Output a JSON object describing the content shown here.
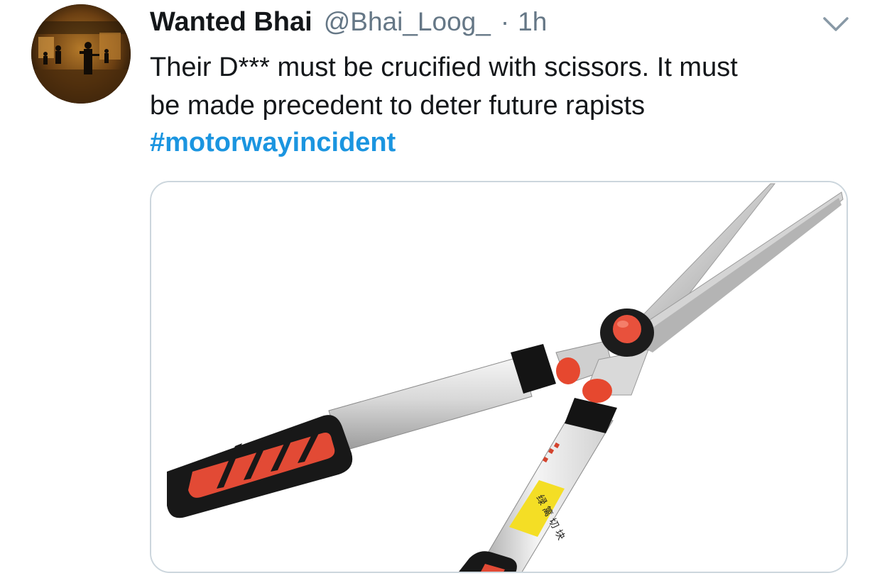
{
  "tweet": {
    "author_name": "Wanted Bhai",
    "handle": "@Bhai_Loog_",
    "separator": "·",
    "time": "1h",
    "text_lines": [
      "Their D*** must be crucified with scissors. It must",
      "be made precedent to deter future rapists"
    ],
    "hashtag": "#motorwayincident"
  },
  "icons": {
    "more": "chevron-down-icon",
    "avatar": "profile-photo"
  },
  "media": {
    "subject": "hedge-shears-photo",
    "label_chars": [
      "绿",
      "篱",
      "切",
      "块"
    ]
  },
  "colors": {
    "text": "#14171a",
    "secondary": "#657786",
    "link": "#1b95e0",
    "border": "#ccd6dd"
  }
}
